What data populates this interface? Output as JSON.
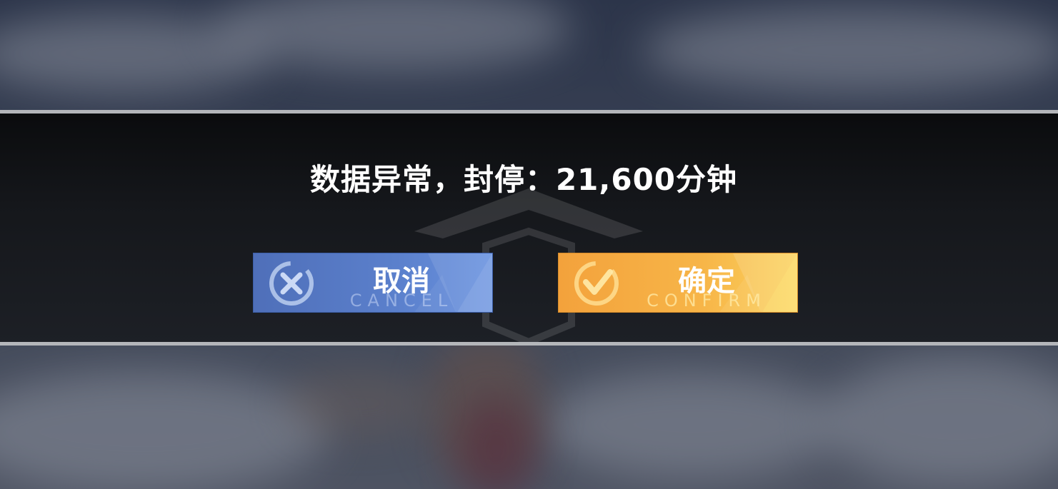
{
  "dialog": {
    "message": "数据异常，封停：21,600分钟"
  },
  "buttons": {
    "cancel": {
      "label": "取消",
      "sublabel": "CANCEL",
      "color": "#5b80cc"
    },
    "confirm": {
      "label": "确定",
      "sublabel": "CONFIRM",
      "color": "#f7b548"
    }
  },
  "icons": {
    "cancel": "x-circle-icon",
    "confirm": "check-circle-icon"
  }
}
